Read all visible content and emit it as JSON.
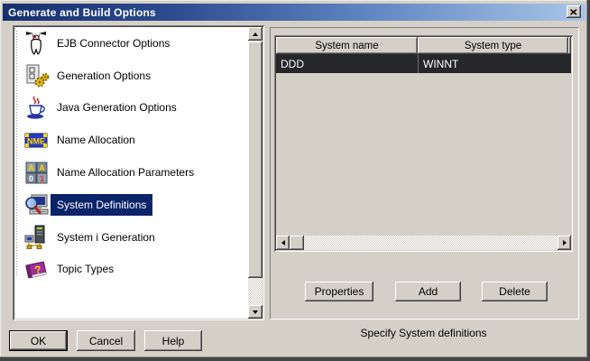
{
  "window": {
    "title": "Generate and Build Options"
  },
  "colors": {
    "dialog_bg": "#d4d0c8",
    "titlebar_gradient_start": "#16306e",
    "titlebar_gradient_end": "#a9c6e8",
    "list_selection_bg": "#0a246a",
    "table_selection_bg": "#26272b",
    "selection_text": "#ffffff"
  },
  "sidebar": {
    "items": [
      {
        "label": "EJB Connector Options",
        "icon": "ejb-connector-icon",
        "selected": false
      },
      {
        "label": "Generation Options",
        "icon": "generation-options-icon",
        "selected": false
      },
      {
        "label": "Java Generation Options",
        "icon": "java-generation-icon",
        "selected": false
      },
      {
        "label": "Name Allocation",
        "icon": "name-allocation-icon",
        "selected": false
      },
      {
        "label": "Name Allocation Parameters",
        "icon": "name-allocation-parameters-icon",
        "selected": false
      },
      {
        "label": "System Definitions",
        "icon": "system-definitions-icon",
        "selected": true
      },
      {
        "label": "System i Generation",
        "icon": "system-i-generation-icon",
        "selected": false
      },
      {
        "label": "Topic Types",
        "icon": "topic-types-icon",
        "selected": false
      }
    ]
  },
  "table": {
    "columns": [
      "System name",
      "System type"
    ],
    "rows": [
      {
        "name": "DDD",
        "type": "WINNT"
      }
    ],
    "selected_row": 0
  },
  "actions": {
    "properties": "Properties",
    "add": "Add",
    "delete": "Delete"
  },
  "status": "Specify System definitions",
  "footer": {
    "ok": "OK",
    "cancel": "Cancel",
    "help": "Help"
  }
}
